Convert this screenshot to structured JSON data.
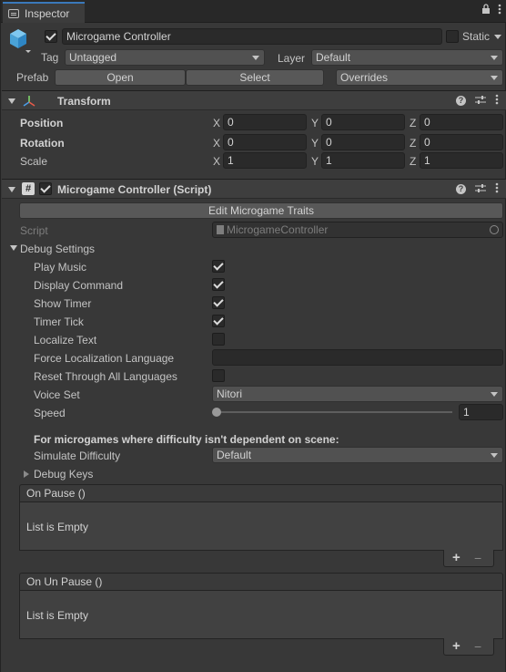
{
  "window": {
    "tab_label": "Inspector",
    "lock_icon": "lock-icon",
    "menu_icon": "kebab-menu-icon"
  },
  "gameobject": {
    "name": "Microgame Controller",
    "active": true,
    "static_label": "Static",
    "tag_label": "Tag",
    "tag_value": "Untagged",
    "layer_label": "Layer",
    "layer_value": "Default",
    "prefab_label": "Prefab",
    "open_label": "Open",
    "select_label": "Select",
    "overrides_label": "Overrides"
  },
  "transform": {
    "title": "Transform",
    "position_label": "Position",
    "rotation_label": "Rotation",
    "scale_label": "Scale",
    "axis_x": "X",
    "axis_y": "Y",
    "axis_z": "Z",
    "position": {
      "x": "0",
      "y": "0",
      "z": "0"
    },
    "rotation": {
      "x": "0",
      "y": "0",
      "z": "0"
    },
    "scale": {
      "x": "1",
      "y": "1",
      "z": "1"
    }
  },
  "script_component": {
    "title": "Microgame Controller (Script)",
    "enabled": true,
    "edit_button": "Edit Microgame Traits",
    "script_label": "Script",
    "script_value": "MicrogameController",
    "debug_settings_label": "Debug Settings",
    "fields": {
      "play_music": {
        "label": "Play Music",
        "checked": true
      },
      "display_command": {
        "label": "Display Command",
        "checked": true
      },
      "show_timer": {
        "label": "Show Timer",
        "checked": true
      },
      "timer_tick": {
        "label": "Timer Tick",
        "checked": true
      },
      "localize_text": {
        "label": "Localize Text",
        "checked": false
      },
      "force_language": {
        "label": "Force Localization Language",
        "value": ""
      },
      "reset_languages": {
        "label": "Reset Through All Languages",
        "checked": false
      },
      "voice_set": {
        "label": "Voice Set",
        "value": "Nitori"
      },
      "speed": {
        "label": "Speed",
        "value": "1",
        "slider_fraction": 0
      }
    },
    "difficulty_heading": "For microgames where difficulty isn't dependent on scene:",
    "simulate_difficulty_label": "Simulate Difficulty",
    "simulate_difficulty_value": "Default",
    "debug_keys_label": "Debug Keys",
    "on_pause": {
      "header": "On Pause ()",
      "empty_text": "List is Empty"
    },
    "on_unpause": {
      "header": "On Un Pause ()",
      "empty_text": "List is Empty"
    },
    "plus": "+",
    "minus": "−"
  },
  "colors": {
    "accent": "#3a79bb",
    "panel": "#383838",
    "field": "#2a2a2a"
  }
}
